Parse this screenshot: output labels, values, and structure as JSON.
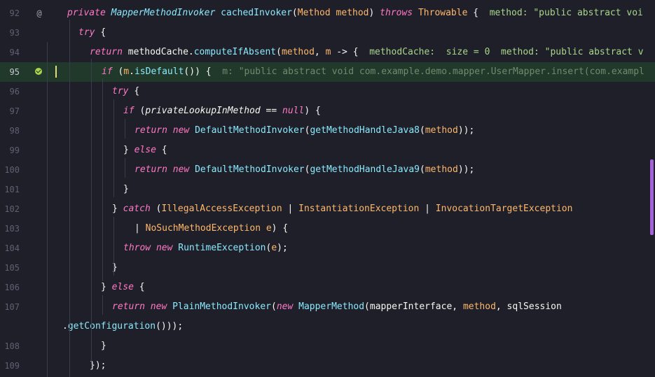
{
  "editor": {
    "lines": [
      {
        "n": "92",
        "tokens": [
          [
            "kw",
            "private "
          ],
          [
            "fnit",
            "MapperMethodInvoker"
          ],
          [
            "pl",
            " "
          ],
          [
            "fn",
            "cachedInvoker"
          ],
          [
            "pl",
            "("
          ],
          [
            "ty",
            "Method "
          ],
          [
            "par",
            "method"
          ],
          [
            "pl",
            ") "
          ],
          [
            "kw",
            "throws "
          ],
          [
            "ty",
            "Throwable "
          ],
          [
            "pl",
            "{  "
          ],
          [
            "hint",
            "method: \"public abstract voi"
          ]
        ]
      },
      {
        "n": "93",
        "tokens": [
          [
            "kw",
            "try "
          ],
          [
            "pl",
            "{"
          ]
        ]
      },
      {
        "n": "94",
        "tokens": [
          [
            "kw",
            "return "
          ],
          [
            "pl",
            "methodCache."
          ],
          [
            "fn",
            "computeIfAbsent"
          ],
          [
            "pl",
            "("
          ],
          [
            "par",
            "method"
          ],
          [
            "pl",
            ", "
          ],
          [
            "par",
            "m"
          ],
          [
            "pl",
            " -> {  "
          ],
          [
            "hint",
            "methodCache:  size = 0  method: \"public abstract v"
          ]
        ]
      },
      {
        "n": "95",
        "tokens": [
          [
            "kw",
            "if "
          ],
          [
            "pl",
            "("
          ],
          [
            "par",
            "m"
          ],
          [
            "pl",
            "."
          ],
          [
            "fn",
            "isDefault"
          ],
          [
            "pl",
            "()) {  "
          ],
          [
            "hint2",
            "m: \"public abstract void com.example.demo.mapper.UserMapper.insert(com.exampl"
          ]
        ]
      },
      {
        "n": "96",
        "tokens": [
          [
            "kw",
            "try "
          ],
          [
            "pl",
            "{"
          ]
        ]
      },
      {
        "n": "97",
        "tokens": [
          [
            "kw",
            "if "
          ],
          [
            "pl",
            "("
          ],
          [
            "varit",
            "privateLookupInMethod"
          ],
          [
            "pl",
            " == "
          ],
          [
            "kw",
            "null"
          ],
          [
            "pl",
            ") {"
          ]
        ]
      },
      {
        "n": "98",
        "tokens": [
          [
            "kw",
            "return new "
          ],
          [
            "fn",
            "DefaultMethodInvoker"
          ],
          [
            "pl",
            "("
          ],
          [
            "fn",
            "getMethodHandleJava8"
          ],
          [
            "pl",
            "("
          ],
          [
            "par",
            "method"
          ],
          [
            "pl",
            "));"
          ]
        ]
      },
      {
        "n": "99",
        "tokens": [
          [
            "pl",
            "} "
          ],
          [
            "kw",
            "else "
          ],
          [
            "pl",
            "{"
          ]
        ]
      },
      {
        "n": "100",
        "tokens": [
          [
            "kw",
            "return new "
          ],
          [
            "fn",
            "DefaultMethodInvoker"
          ],
          [
            "pl",
            "("
          ],
          [
            "fn",
            "getMethodHandleJava9"
          ],
          [
            "pl",
            "("
          ],
          [
            "par",
            "method"
          ],
          [
            "pl",
            "));"
          ]
        ]
      },
      {
        "n": "101",
        "tokens": [
          [
            "pl",
            "}"
          ]
        ]
      },
      {
        "n": "102",
        "tokens": [
          [
            "pl",
            "} "
          ],
          [
            "kw",
            "catch "
          ],
          [
            "pl",
            "("
          ],
          [
            "ty",
            "IllegalAccessException"
          ],
          [
            "pl",
            " | "
          ],
          [
            "ty",
            "InstantiationException"
          ],
          [
            "pl",
            " | "
          ],
          [
            "ty",
            "InvocationTargetException"
          ]
        ]
      },
      {
        "n": "103",
        "tokens": [
          [
            "pl",
            "| "
          ],
          [
            "ty",
            "NoSuchMethodException "
          ],
          [
            "par",
            "e"
          ],
          [
            "pl",
            ") {"
          ]
        ]
      },
      {
        "n": "104",
        "tokens": [
          [
            "kw",
            "throw new "
          ],
          [
            "fn",
            "RuntimeException"
          ],
          [
            "pl",
            "("
          ],
          [
            "par",
            "e"
          ],
          [
            "pl",
            ");"
          ]
        ]
      },
      {
        "n": "105",
        "tokens": [
          [
            "pl",
            "}"
          ]
        ]
      },
      {
        "n": "106",
        "tokens": [
          [
            "pl",
            "} "
          ],
          [
            "kw",
            "else "
          ],
          [
            "pl",
            "{"
          ]
        ]
      },
      {
        "n": "107",
        "tokens": [
          [
            "kw",
            "return new "
          ],
          [
            "fn",
            "PlainMethodInvoker"
          ],
          [
            "pl",
            "("
          ],
          [
            "kw",
            "new "
          ],
          [
            "fn",
            "MapperMethod"
          ],
          [
            "pl",
            "(mapperInterface, "
          ],
          [
            "par",
            "method"
          ],
          [
            "pl",
            ", sqlSession"
          ]
        ]
      },
      {
        "n": "",
        "tokens": [
          [
            "pl",
            "."
          ],
          [
            "fn",
            "getConfiguration"
          ],
          [
            "pl",
            "()));"
          ]
        ]
      },
      {
        "n": "108",
        "tokens": [
          [
            "pl",
            "}"
          ]
        ]
      },
      {
        "n": "109",
        "tokens": [
          [
            "pl",
            "});"
          ]
        ]
      }
    ],
    "gutter_marks": {
      "92": "@",
      "95": "check-icon"
    }
  }
}
